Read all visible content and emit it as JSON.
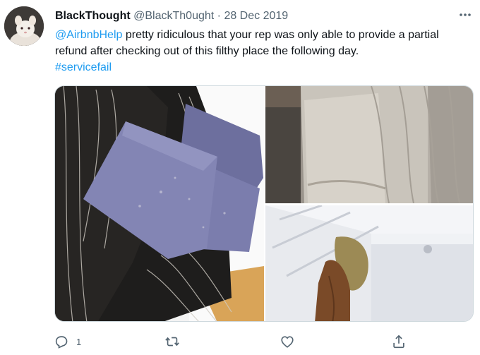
{
  "tweet": {
    "author_name": "BlackThought",
    "handle": "@BlackTh0ught",
    "separator": "·",
    "date": "28 Dec 2019",
    "mention": "@AirbnbHelp",
    "body": " pretty ridiculous that your rep was only able to provide a partial refund after checking out of this filthy place the following day.",
    "hashtag": "#servicefail"
  },
  "actions": {
    "reply_count": "1"
  },
  "icons": {
    "more": "more-horizontal-icon",
    "reply": "reply-icon",
    "retweet": "retweet-icon",
    "like": "heart-icon",
    "share": "share-icon"
  },
  "colors": {
    "link": "#1d9bf0",
    "secondary_text": "#536471",
    "primary_text": "#0f1419"
  }
}
